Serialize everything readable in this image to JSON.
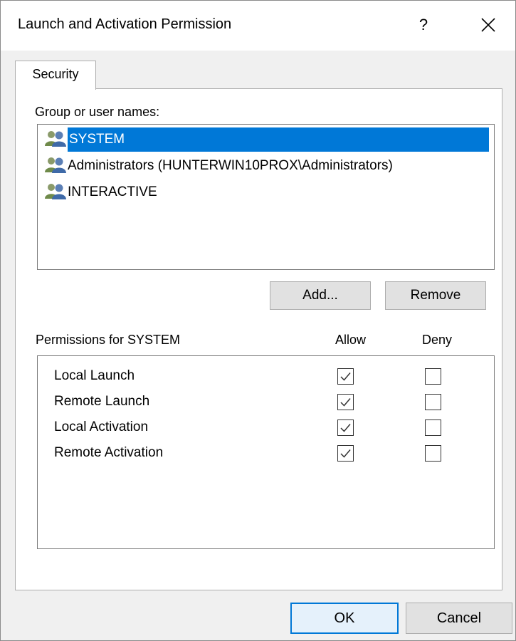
{
  "dialog": {
    "title": "Launch and Activation Permission",
    "help_label": "?"
  },
  "tabs": [
    {
      "label": "Security",
      "active": true
    }
  ],
  "group_section": {
    "label": "Group or user names:",
    "items": [
      {
        "name": "SYSTEM",
        "icon": "user-group-icon",
        "selected": true
      },
      {
        "name": "Administrators (HUNTERWIN10PROX\\Administrators)",
        "icon": "user-group-icon",
        "selected": false
      },
      {
        "name": "INTERACTIVE",
        "icon": "user-group-icon",
        "selected": false
      }
    ],
    "add_label": "Add...",
    "remove_label": "Remove"
  },
  "permissions": {
    "header": "Permissions for SYSTEM",
    "allow_label": "Allow",
    "deny_label": "Deny",
    "rows": [
      {
        "name": "Local Launch",
        "allow": true,
        "deny": false
      },
      {
        "name": "Remote Launch",
        "allow": true,
        "deny": false
      },
      {
        "name": "Local Activation",
        "allow": true,
        "deny": false
      },
      {
        "name": "Remote Activation",
        "allow": true,
        "deny": false
      }
    ]
  },
  "footer": {
    "ok_label": "OK",
    "cancel_label": "Cancel"
  },
  "colors": {
    "selection": "#0078d7",
    "check": "#333333"
  }
}
